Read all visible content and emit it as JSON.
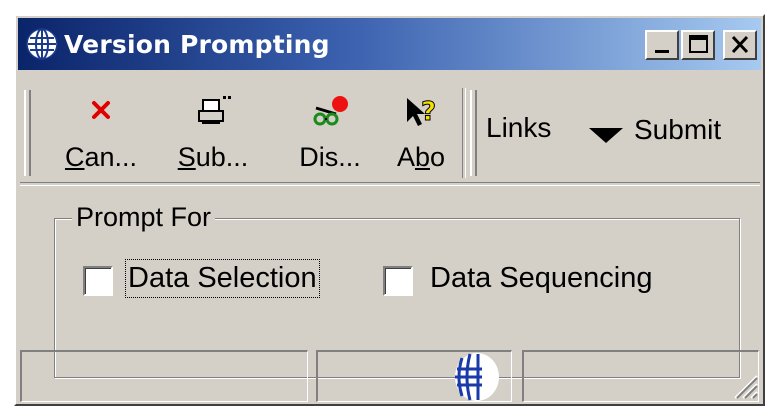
{
  "window": {
    "title": "Version Prompting",
    "controls": {
      "minimize": "_",
      "maximize": "□",
      "close": "X"
    }
  },
  "toolbar": {
    "buttons": [
      {
        "id": "cancel",
        "label": "Can...",
        "mnemonic": "C",
        "rest": "an...",
        "icon": "red-x-icon"
      },
      {
        "id": "submit",
        "label": "Sub...",
        "mnemonic": "S",
        "rest": "ub...",
        "icon": "printer-icon"
      },
      {
        "id": "display",
        "label": "Dis...",
        "mnemonic": "",
        "rest": "Dis...",
        "icon": "glasses-icon"
      },
      {
        "id": "about",
        "label": "Abo",
        "mnemonic": "b",
        "rest": "Abo",
        "icon": "help-pointer-icon"
      }
    ],
    "links_label": "Links",
    "submit_menu_label": "Submit"
  },
  "prompt_group": {
    "legend": "Prompt For",
    "options": [
      {
        "label": "Data Selection",
        "checked": false,
        "focused": true
      },
      {
        "label": "Data Sequencing",
        "checked": false,
        "focused": false
      }
    ]
  },
  "status_bar": {
    "panels": [
      "",
      "",
      ""
    ],
    "icon": "globe-icon"
  },
  "colors": {
    "title_start": "#0a246a",
    "title_end": "#a6caf0",
    "face": "#d4d0c8",
    "cancel_red": "#e00000"
  }
}
